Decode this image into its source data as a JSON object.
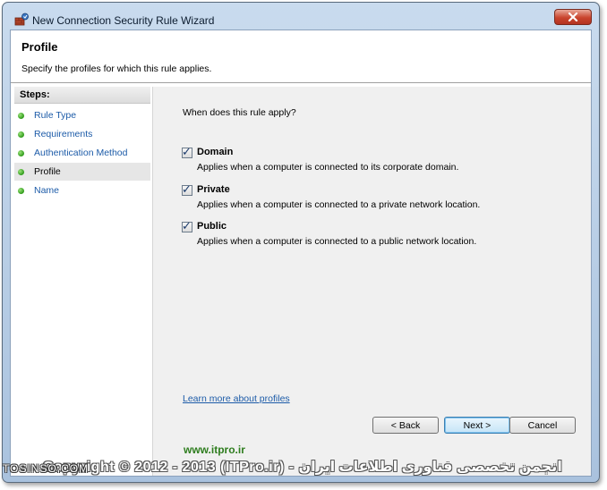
{
  "window": {
    "title": "New Connection Security Rule Wizard",
    "close_icon": "close-icon"
  },
  "header": {
    "title": "Profile",
    "subtitle": "Specify the profiles for which this rule applies."
  },
  "steps": {
    "title": "Steps:",
    "items": [
      {
        "label": "Rule Type",
        "current": false
      },
      {
        "label": "Requirements",
        "current": false
      },
      {
        "label": "Authentication Method",
        "current": false
      },
      {
        "label": "Profile",
        "current": true
      },
      {
        "label": "Name",
        "current": false
      }
    ]
  },
  "content": {
    "question": "When does this rule apply?",
    "options": [
      {
        "label": "Domain",
        "checked": true,
        "description": "Applies when a computer is connected to its corporate domain."
      },
      {
        "label": "Private",
        "checked": true,
        "description": "Applies when a computer is connected to a private network location."
      },
      {
        "label": "Public",
        "checked": true,
        "description": "Applies when a computer is connected to a public network location."
      }
    ],
    "learn_more": "Learn more about profiles"
  },
  "buttons": {
    "back": "< Back",
    "next": "Next >",
    "cancel": "Cancel"
  },
  "watermark": {
    "url": "www.itpro.ir",
    "copyright": "Copyright © 2012 - 2013 (ITPro.ir) - انجمن تخصصی فناوری اطلاعات ایران",
    "brand": "TOSINSO.COM"
  },
  "colors": {
    "accent": "#1c5ba8",
    "step_dot": "#2f9a1a",
    "watermark_url": "#2e7d1e"
  }
}
